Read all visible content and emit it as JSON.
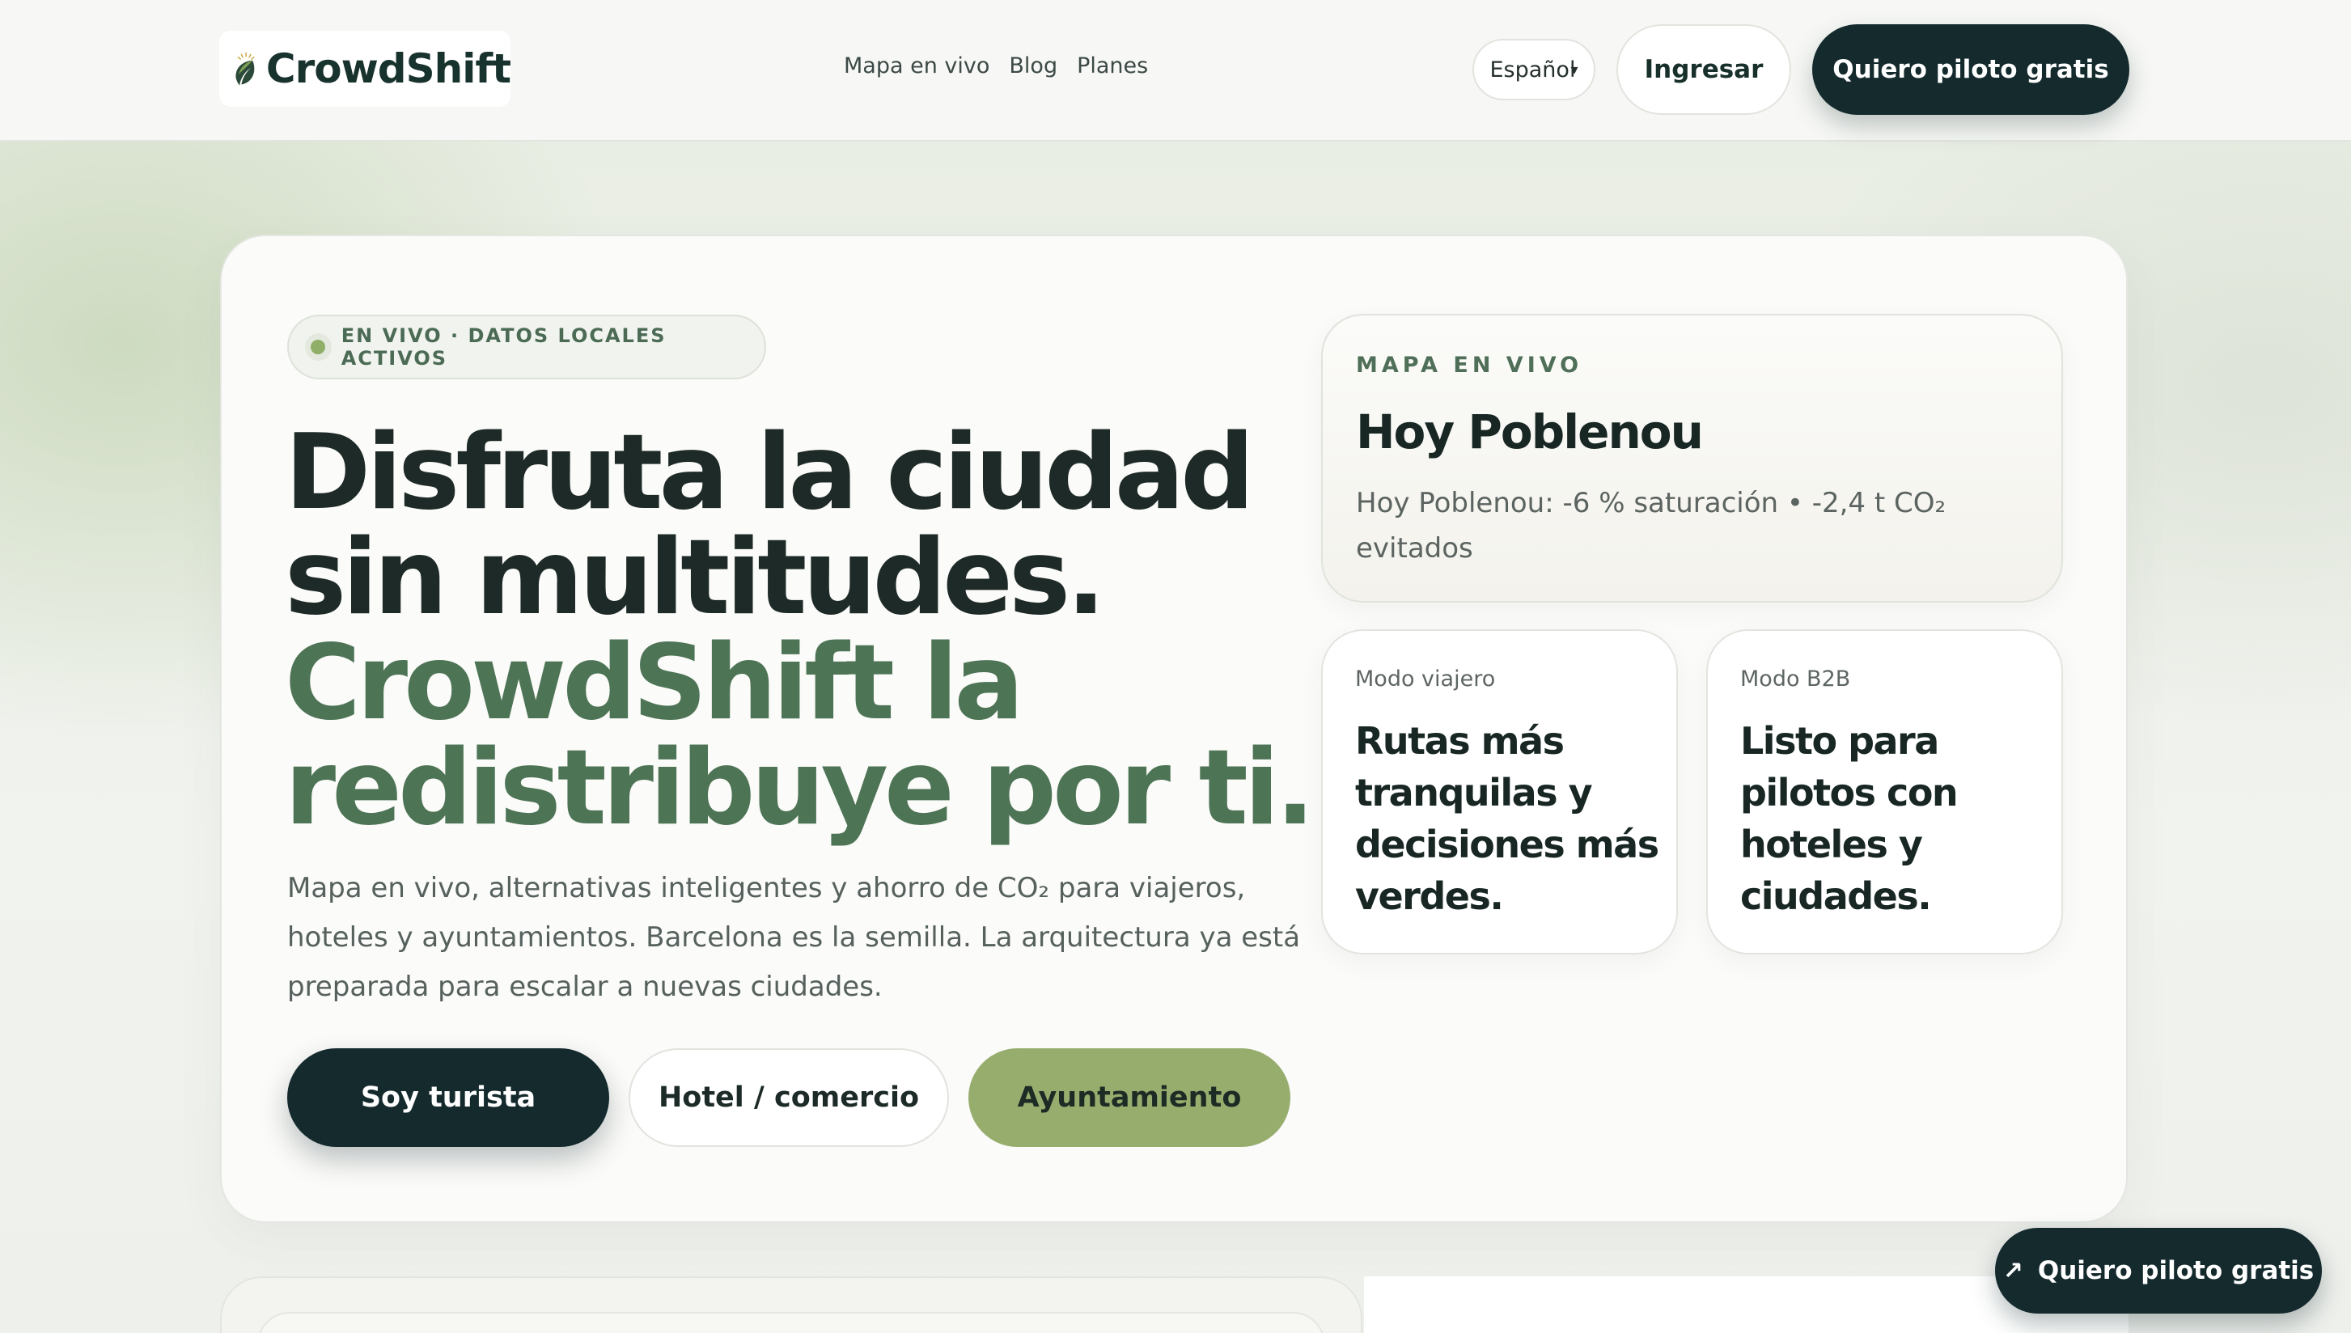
{
  "header": {
    "brand": "CrowdShift",
    "nav": [
      "Mapa en vivo",
      "Blog",
      "Planes"
    ],
    "language": "Español",
    "login_label": "Ingresar",
    "pilot_label": "Quiero piloto gratis"
  },
  "hero": {
    "badge": "EN VIVO · DATOS LOCALES ACTIVOS",
    "headline_line1": "Disfruta la ciudad",
    "headline_line2": "sin multitudes.",
    "headline_line3": "CrowdShift la",
    "headline_line4": "redistribuye por ti.",
    "lede": "Mapa en vivo, alternativas inteligentes y ahorro de CO₂ para viajeros, hoteles y ayuntamientos. Barcelona es la semilla. La arquitectura ya está preparada para escalar a nuevas ciudades.",
    "cta": {
      "tourist": "Soy turista",
      "hotel": "Hotel / comercio",
      "city": "Ayuntamiento"
    }
  },
  "map_card": {
    "kicker": "MAPA EN VIVO",
    "title": "Hoy Poblenou",
    "description": "Hoy Poblenou: -6 % saturación • -2,4 t CO₂ evitados"
  },
  "modes": [
    {
      "label": "Modo viajero",
      "title": "Rutas más tranquilas y decisiones más verdes."
    },
    {
      "label": "Modo B2B",
      "title": "Listo para pilotos con hoteles y ciudades."
    }
  ],
  "floating_cta": {
    "label": "Quiero piloto gratis"
  },
  "colors": {
    "dark": "#142a2d",
    "accent_green": "#4e7456",
    "olive": "#97ad6e",
    "live_dot": "#8fae68"
  },
  "icons": {
    "logo": "leaf-sun-logo",
    "language_chevron": "chevron-down-icon",
    "floating_arrow": "arrow-up-right-icon",
    "live_dot": "live-dot-icon"
  }
}
